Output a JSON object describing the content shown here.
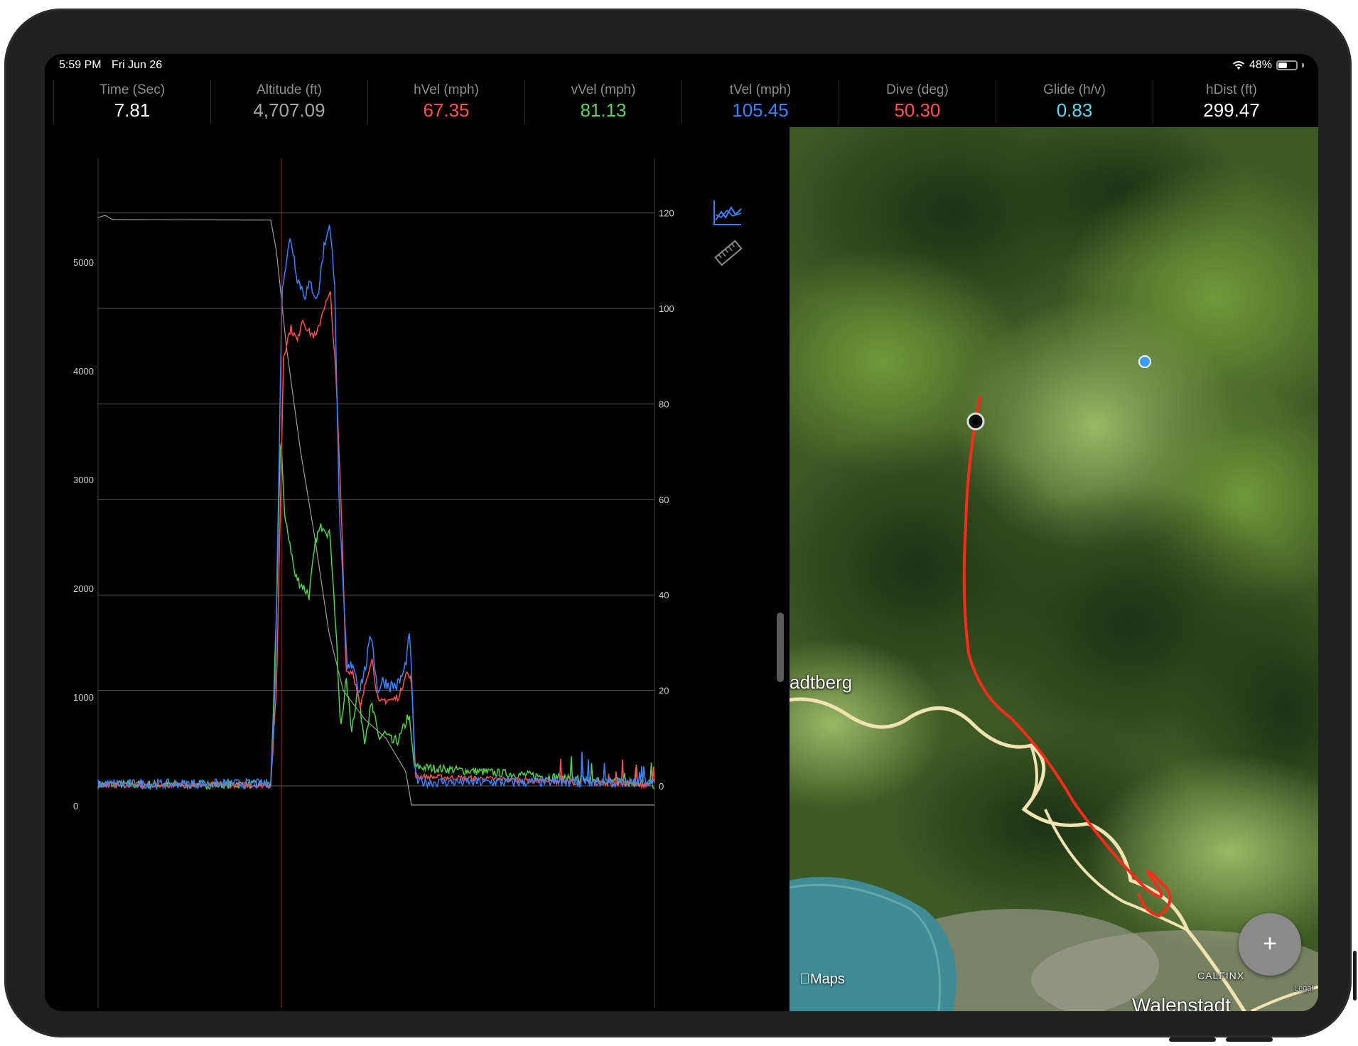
{
  "status_bar": {
    "time": "5:59 PM",
    "date": "Fri Jun 26",
    "battery": "48%",
    "battery_level": 0.48
  },
  "metrics": [
    {
      "label": "Time (Sec)",
      "value": "7.81",
      "color": "#ffffff"
    },
    {
      "label": "Altitude (ft)",
      "value": "4,707.09",
      "color": "#a6a6a6"
    },
    {
      "label": "hVel (mph)",
      "value": "67.35",
      "color": "#ff4f4f"
    },
    {
      "label": "vVel (mph)",
      "value": "81.13",
      "color": "#5ed05e"
    },
    {
      "label": "tVel (mph)",
      "value": "105.45",
      "color": "#3b82ff"
    },
    {
      "label": "Dive (deg)",
      "value": "50.30",
      "color": "#ff4f4f"
    },
    {
      "label": "Glide (h/v)",
      "value": "0.83",
      "color": "#5fd8ef"
    },
    {
      "label": "hDist (ft)",
      "value": "299.47",
      "color": "#ffffff"
    }
  ],
  "chart": {
    "left_ticks": [
      "5000",
      "4000",
      "3000",
      "2000",
      "1000",
      "0"
    ],
    "right_ticks": [
      "120",
      "100",
      "80",
      "60",
      "40",
      "20",
      "0"
    ],
    "colors": {
      "hVel": "#ff4f4f",
      "vVel": "#4fd04f",
      "tVel": "#3b82ff",
      "altitude": "#9c9c9c",
      "cursor": "#b02020"
    },
    "icons": {
      "chart_type": "line-chart-icon",
      "measure": "ruler-icon"
    }
  },
  "map": {
    "place_labels": {
      "town_partial": "adtberg",
      "town_main": "Walenstadt",
      "locality": "CALFINX",
      "legal": "Legal"
    },
    "attribution": "Maps",
    "track_color": "#ff2a1a",
    "add_button": "+"
  }
}
